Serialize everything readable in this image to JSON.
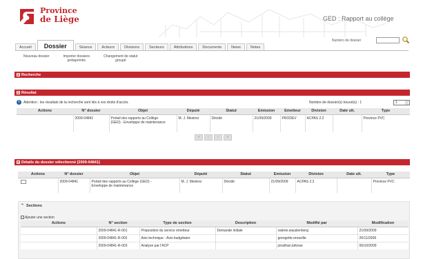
{
  "brand": {
    "line1": "Province",
    "line2": "de Liège"
  },
  "app_title": "GED : Rapport au collège",
  "search": {
    "label": "Numéro de dossier"
  },
  "tabs": [
    {
      "label": "Accueil"
    },
    {
      "label": "Dossier",
      "active": true
    },
    {
      "label": "Séance"
    },
    {
      "label": "Acteurs"
    },
    {
      "label": "Divisions"
    },
    {
      "label": "Secteurs"
    },
    {
      "label": "Attributions"
    },
    {
      "label": "Documents"
    },
    {
      "label": "News"
    },
    {
      "label": "Notes"
    }
  ],
  "submenu": [
    {
      "line1": "Nouveau dossier",
      "line2": ""
    },
    {
      "line1": "Importer dossiers",
      "line2": "prétaprimés"
    },
    {
      "line1": "Changement de statut",
      "line2": "groupé"
    }
  ],
  "sections": {
    "recherche": "Recherche",
    "resultat": "Résultat",
    "details": "Détails du dossier sélectionné [2009-04841]",
    "sections": "Sections"
  },
  "info": {
    "attention": "Attention : les résultats de la recherche sont liés à vos droits d'accès.",
    "count_label": "Nombre de dossier(s) trouvé(s) : 1",
    "page_value": "1"
  },
  "result_table": {
    "headers": [
      "Actions",
      "N° dossier",
      "Objet",
      "Député",
      "Statut",
      "Emission",
      "Emetteur",
      "Division",
      "Date ult.",
      "Type"
    ],
    "row": {
      "numero": "2009-04841",
      "objet_l1": "Portail des rapports au Collège",
      "objet_l2": "(GED) - Enveloppe de maintenance",
      "depute": "M. J. Mestrez",
      "statut": "Décidé",
      "emission": "21/09/2009",
      "emetteur": "PRODEV",
      "division": "ACPAS 2.2",
      "date_ult": "",
      "type": "Province PVC"
    }
  },
  "detail_table": {
    "headers": [
      "Actions",
      "N° dossier",
      "Objet",
      "Député",
      "Statut",
      "Emission",
      "Division",
      "Date ult.",
      "Type"
    ],
    "row": {
      "numero": "2009-04841",
      "objet_l1": "Portail des rapports au Collège (GED) -",
      "objet_l2": "Enveloppe de maintenance",
      "depute": "M. J. Mestrez",
      "statut": "Décidé",
      "emission": "21/09/2009",
      "division": "ACPAS 2.2",
      "date_ult": "",
      "type": "Province PVC"
    }
  },
  "add_section_label": "Ajouter une section",
  "sections_table": {
    "headers": [
      "Actions",
      "N° section",
      "Type de section",
      "Description",
      "Modifié par",
      "Modification"
    ],
    "rows": [
      {
        "numero": "2009-04841-R-001",
        "type": "Proposition du service émetteur",
        "description": "Demande initiale",
        "modifie_par": "valerie.wauslenberg",
        "modification": "21/09/2009"
      },
      {
        "numero": "2009-04841-R-002",
        "type": "Avis technique - Avis budgétaire",
        "description": "",
        "modifie_par": "georgette.renaville",
        "modification": "26/11/2009"
      },
      {
        "numero": "2009-04841-R-003",
        "type": "Analyse par l'ACP",
        "description": "",
        "modifie_par": "jonathan.lafosse",
        "modification": "06/10/2009"
      }
    ]
  },
  "colors": {
    "accent": "#c4262e",
    "info": "#2a5fa8"
  },
  "icons": {
    "logo": "province-logo",
    "search": "search-icon",
    "info": "info-icon"
  }
}
